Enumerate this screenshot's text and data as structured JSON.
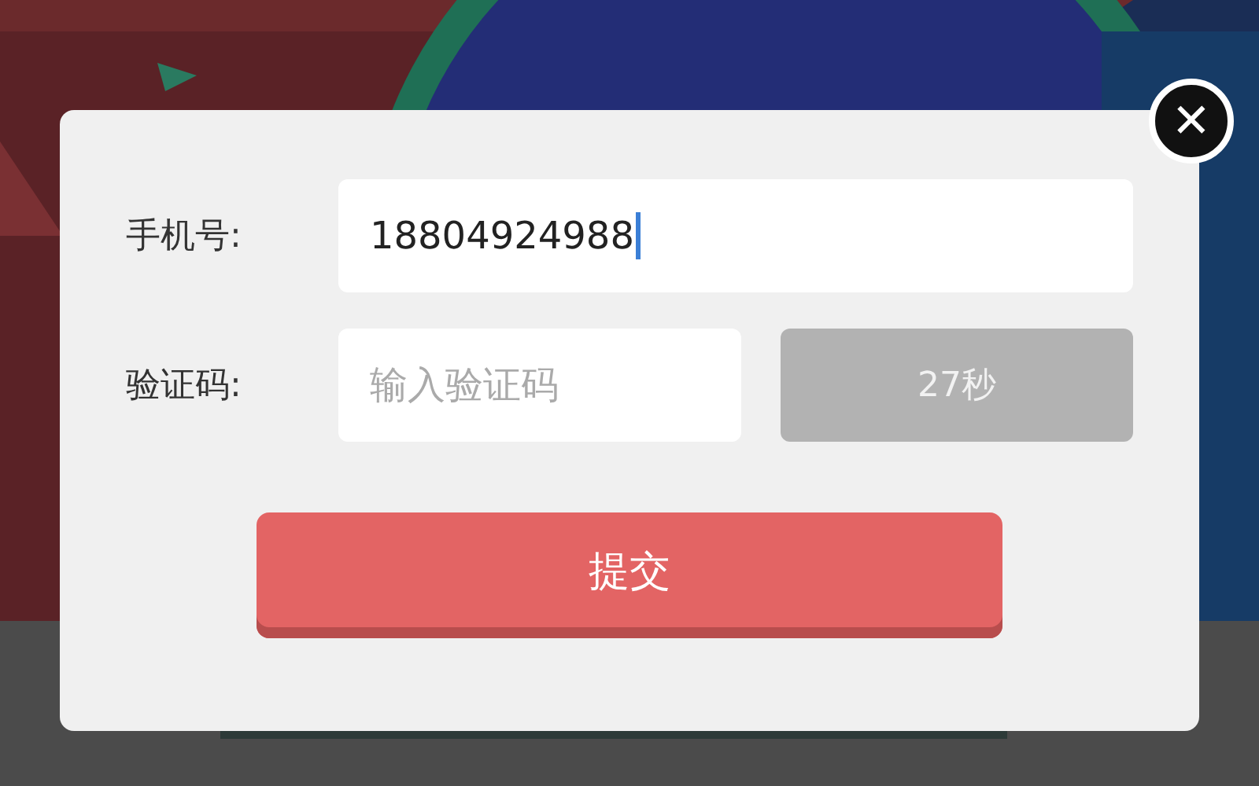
{
  "dialog": {
    "close": "✕",
    "fields": [
      {
        "label": "手机号:",
        "value": "18804924988",
        "focused": true
      },
      {
        "label": "验证码:",
        "placeholder": "输入验证码",
        "focused": false
      }
    ],
    "countdown_button": {
      "label": "27秒",
      "disabled": true
    },
    "submit_button": {
      "label": "提交"
    }
  }
}
